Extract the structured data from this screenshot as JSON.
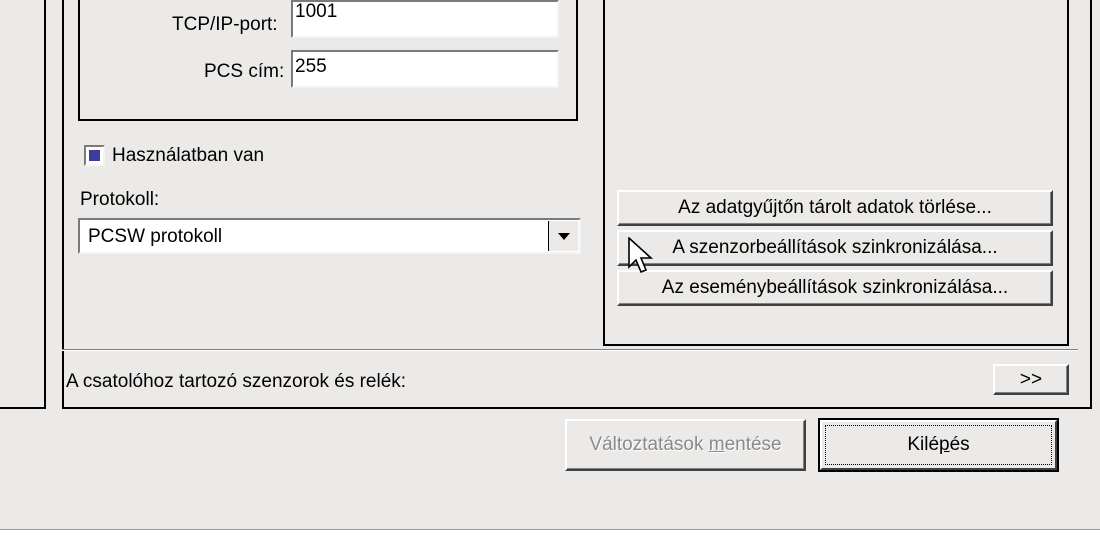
{
  "connection": {
    "tcp_port_label": "TCP/IP-port:",
    "tcp_port_value": "1001",
    "pcs_address_label": "PCS cím:",
    "pcs_address_value": "255"
  },
  "in_use": {
    "label": "Használatban van",
    "checked": true
  },
  "protocol": {
    "label": "Protokoll:",
    "selected": "PCSW protokoll"
  },
  "actions": {
    "delete_data": "Az adatgyűjtőn tárolt adatok törlése...",
    "sync_sensors": "A szenzorbeállítások szinkronizálása...",
    "sync_events": "Az eseménybeállítások szinkronizálása..."
  },
  "sensors_bar": {
    "label": "A csatolóhoz tartozó szenzorok és relék:",
    "expand_label": ">>"
  },
  "footer": {
    "save_prefix": "Változtatások ",
    "save_underlined": "m",
    "save_suffix": "entése",
    "exit_prefix": "Kilé",
    "exit_underlined": "p",
    "exit_suffix": "és"
  },
  "colors": {
    "background": "#ebeae8",
    "checkbox_fill": "#3c3c9c",
    "disabled_text": "#8a8a8a"
  }
}
